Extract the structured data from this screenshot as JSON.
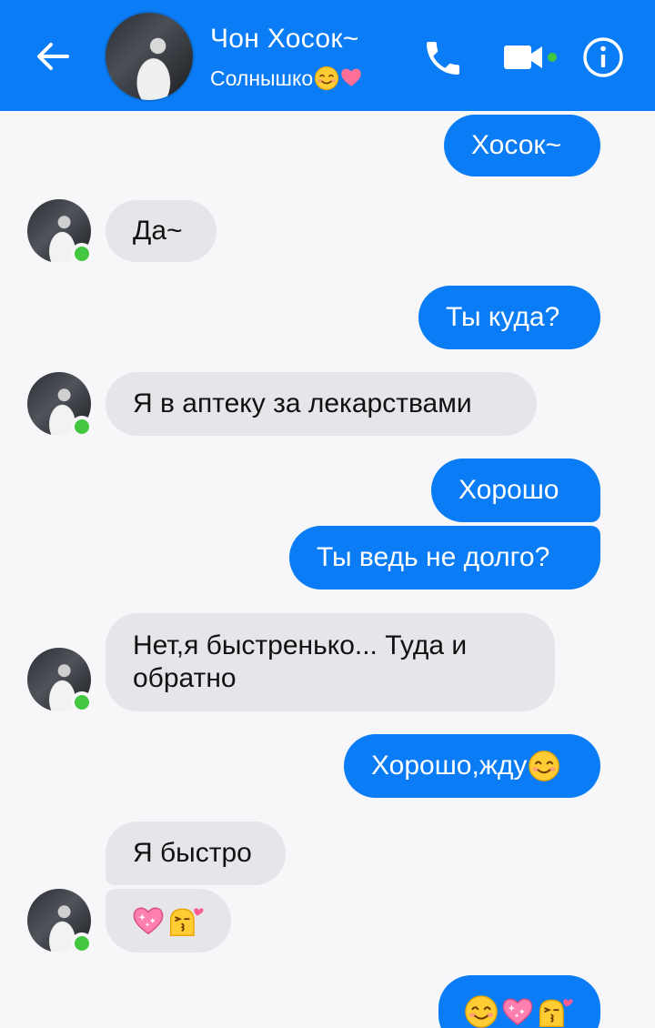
{
  "header": {
    "name": "Чон Хосок~",
    "status": "Солнышко"
  },
  "messages": [
    {
      "side": "out",
      "text": "Хосок~"
    },
    {
      "side": "in",
      "text": "Да~"
    },
    {
      "side": "out",
      "text": "Ты куда?"
    },
    {
      "side": "in",
      "text": "Я в аптеку за лекарствами"
    },
    {
      "side": "out",
      "text": "Хорошо"
    },
    {
      "side": "out",
      "text": "Ты ведь не долго?"
    },
    {
      "side": "in",
      "text": "Нет,я быстренько... Туда и обратно"
    },
    {
      "side": "out",
      "text": "Хорошо,жду"
    },
    {
      "side": "in",
      "text": "Я быстро"
    },
    {
      "side": "in",
      "text": ""
    },
    {
      "side": "out",
      "text": ""
    }
  ],
  "icons": {
    "back": "arrow-left-icon",
    "call": "phone-icon",
    "video": "video-camera-icon",
    "info": "info-icon",
    "emoji_smile": "smiling-face-icon",
    "emoji_heart": "sparkling-heart-icon",
    "emoji_kiss": "kissing-face-icon"
  },
  "colors": {
    "accent": "#0a7cf5",
    "incoming_bubble": "#e6e6ea",
    "online": "#43c640",
    "background": "#f7f7fa"
  }
}
